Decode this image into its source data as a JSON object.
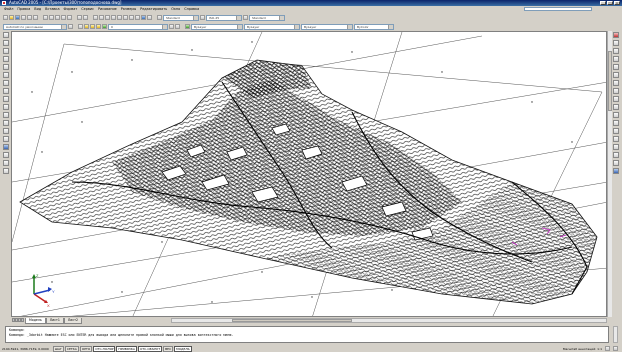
{
  "window": {
    "title": "AutoCAD 2005 - [C:\\Проекты\\300\\топоподоснова.dwg]",
    "controls": [
      "_",
      "□",
      "×"
    ]
  },
  "menu": {
    "items": [
      "Файл",
      "Правка",
      "Вид",
      "Вставка",
      "Формат",
      "Сервис",
      "Рисование",
      "Размеры",
      "Редактировать",
      "Окно",
      "Справка"
    ],
    "search_placeholder": "Введите вопрос"
  },
  "toolbar": {
    "text_style": "Standard",
    "dim_style": "ISO-25",
    "named_view": "Standard",
    "workspace": "AutoCAD по умолчанию",
    "layer": "0",
    "color": "ByLayer",
    "linetype": "ByLayer",
    "lineweight": "ByLayer",
    "plot_style": "ByColor"
  },
  "tabs": [
    "Модель",
    "Лист1",
    "Лист2"
  ],
  "active_tab": "Модель",
  "command_line": {
    "line1": "Команда:",
    "line2": "Команда: _3dorbit  Нажмите ESC или ENTER для выхода или щелкните правой кнопкой мыши для вызова контекстного меню."
  },
  "status": {
    "coords": "2194.5941, 3986.7139, 0.0000",
    "toggles": [
      "ШАГ",
      "СЕТКА",
      "ОРТО",
      "ОТС-ПОЛЯР",
      "ПРИВЯЗКА",
      "ОТС-ОБЪЕКТ",
      "ВЕС",
      "МОДЕЛЬ"
    ],
    "toggles_on": [
      false,
      false,
      false,
      true,
      true,
      true,
      false,
      true
    ],
    "annotation": "Масштаб аннотаций: 1:1"
  },
  "ucs_icon": {
    "x_label": "X",
    "y_label": "Y",
    "z_label": "Z"
  },
  "colors": {
    "accent": "#0a246a",
    "terrain": "#111111",
    "grid": "#444444",
    "highlight": "#c020c0"
  }
}
